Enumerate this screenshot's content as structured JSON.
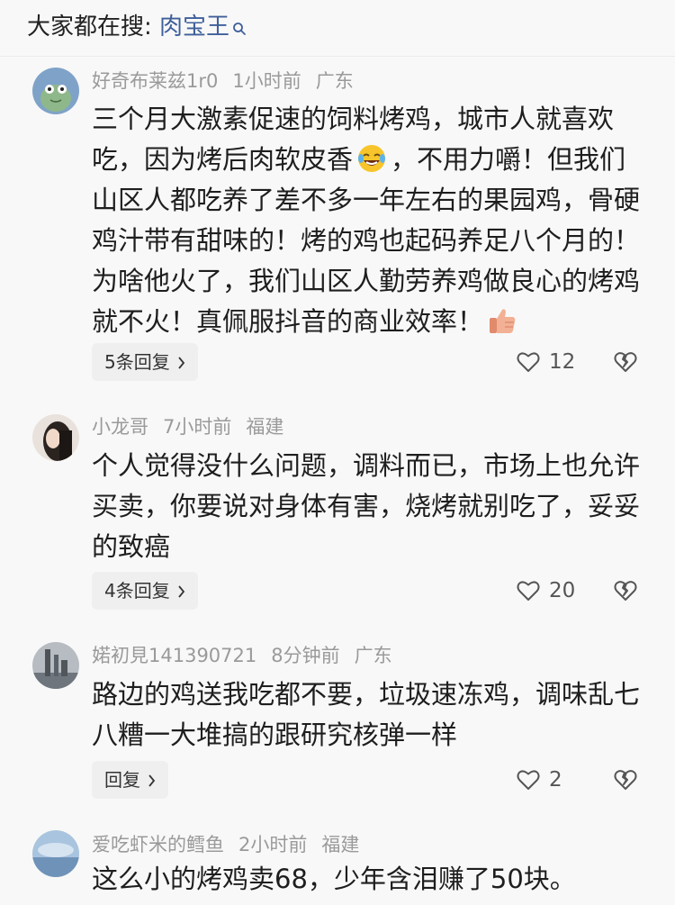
{
  "search": {
    "label": "大家都在搜:",
    "keyword": "肉宝王"
  },
  "comments": [
    {
      "user": "好奇布莱兹1r0",
      "time": "1小时前",
      "location": "广东",
      "text_parts": [
        "三个月大激素促速的饲料烤鸡，城市人就喜欢吃，因为烤后肉软皮香",
        "，不用力嚼！但我们山区人都吃养了差不多一年左右的果园鸡，骨硬鸡汁带有甜味的！烤的鸡也起码养足八个月的！为啥他火了，我们山区人勤劳养鸡做良心的烤鸡就不火！真佩服抖音的商业效率！"
      ],
      "emojis": [
        "laughing-emoji",
        "thumbs-up-emoji"
      ],
      "reply_label": "5条回复",
      "likes": "12"
    },
    {
      "user": "小龙哥",
      "time": "7小时前",
      "location": "福建",
      "text": "个人觉得没什么问题，调料而已，市场上也允许买卖，你要说对身体有害，烧烤就别吃了，妥妥的致癌",
      "reply_label": "4条回复",
      "likes": "20"
    },
    {
      "user": "婼初見141390721",
      "time": "8分钟前",
      "location": "广东",
      "text": "路边的鸡送我吃都不要，垃圾速冻鸡，调味乱七八糟一大堆搞的跟研究核弹一样",
      "reply_label": "回复",
      "likes": "2"
    },
    {
      "user": "爱吃虾米的鳕鱼",
      "time": "2小时前",
      "location": "福建",
      "text": "这么小的烤鸡卖68，少年含泪赚了50块。"
    }
  ],
  "colors": {
    "keyword": "#3f5f9a",
    "meta": "#9a9a9a",
    "background": "#f8f8f8"
  }
}
